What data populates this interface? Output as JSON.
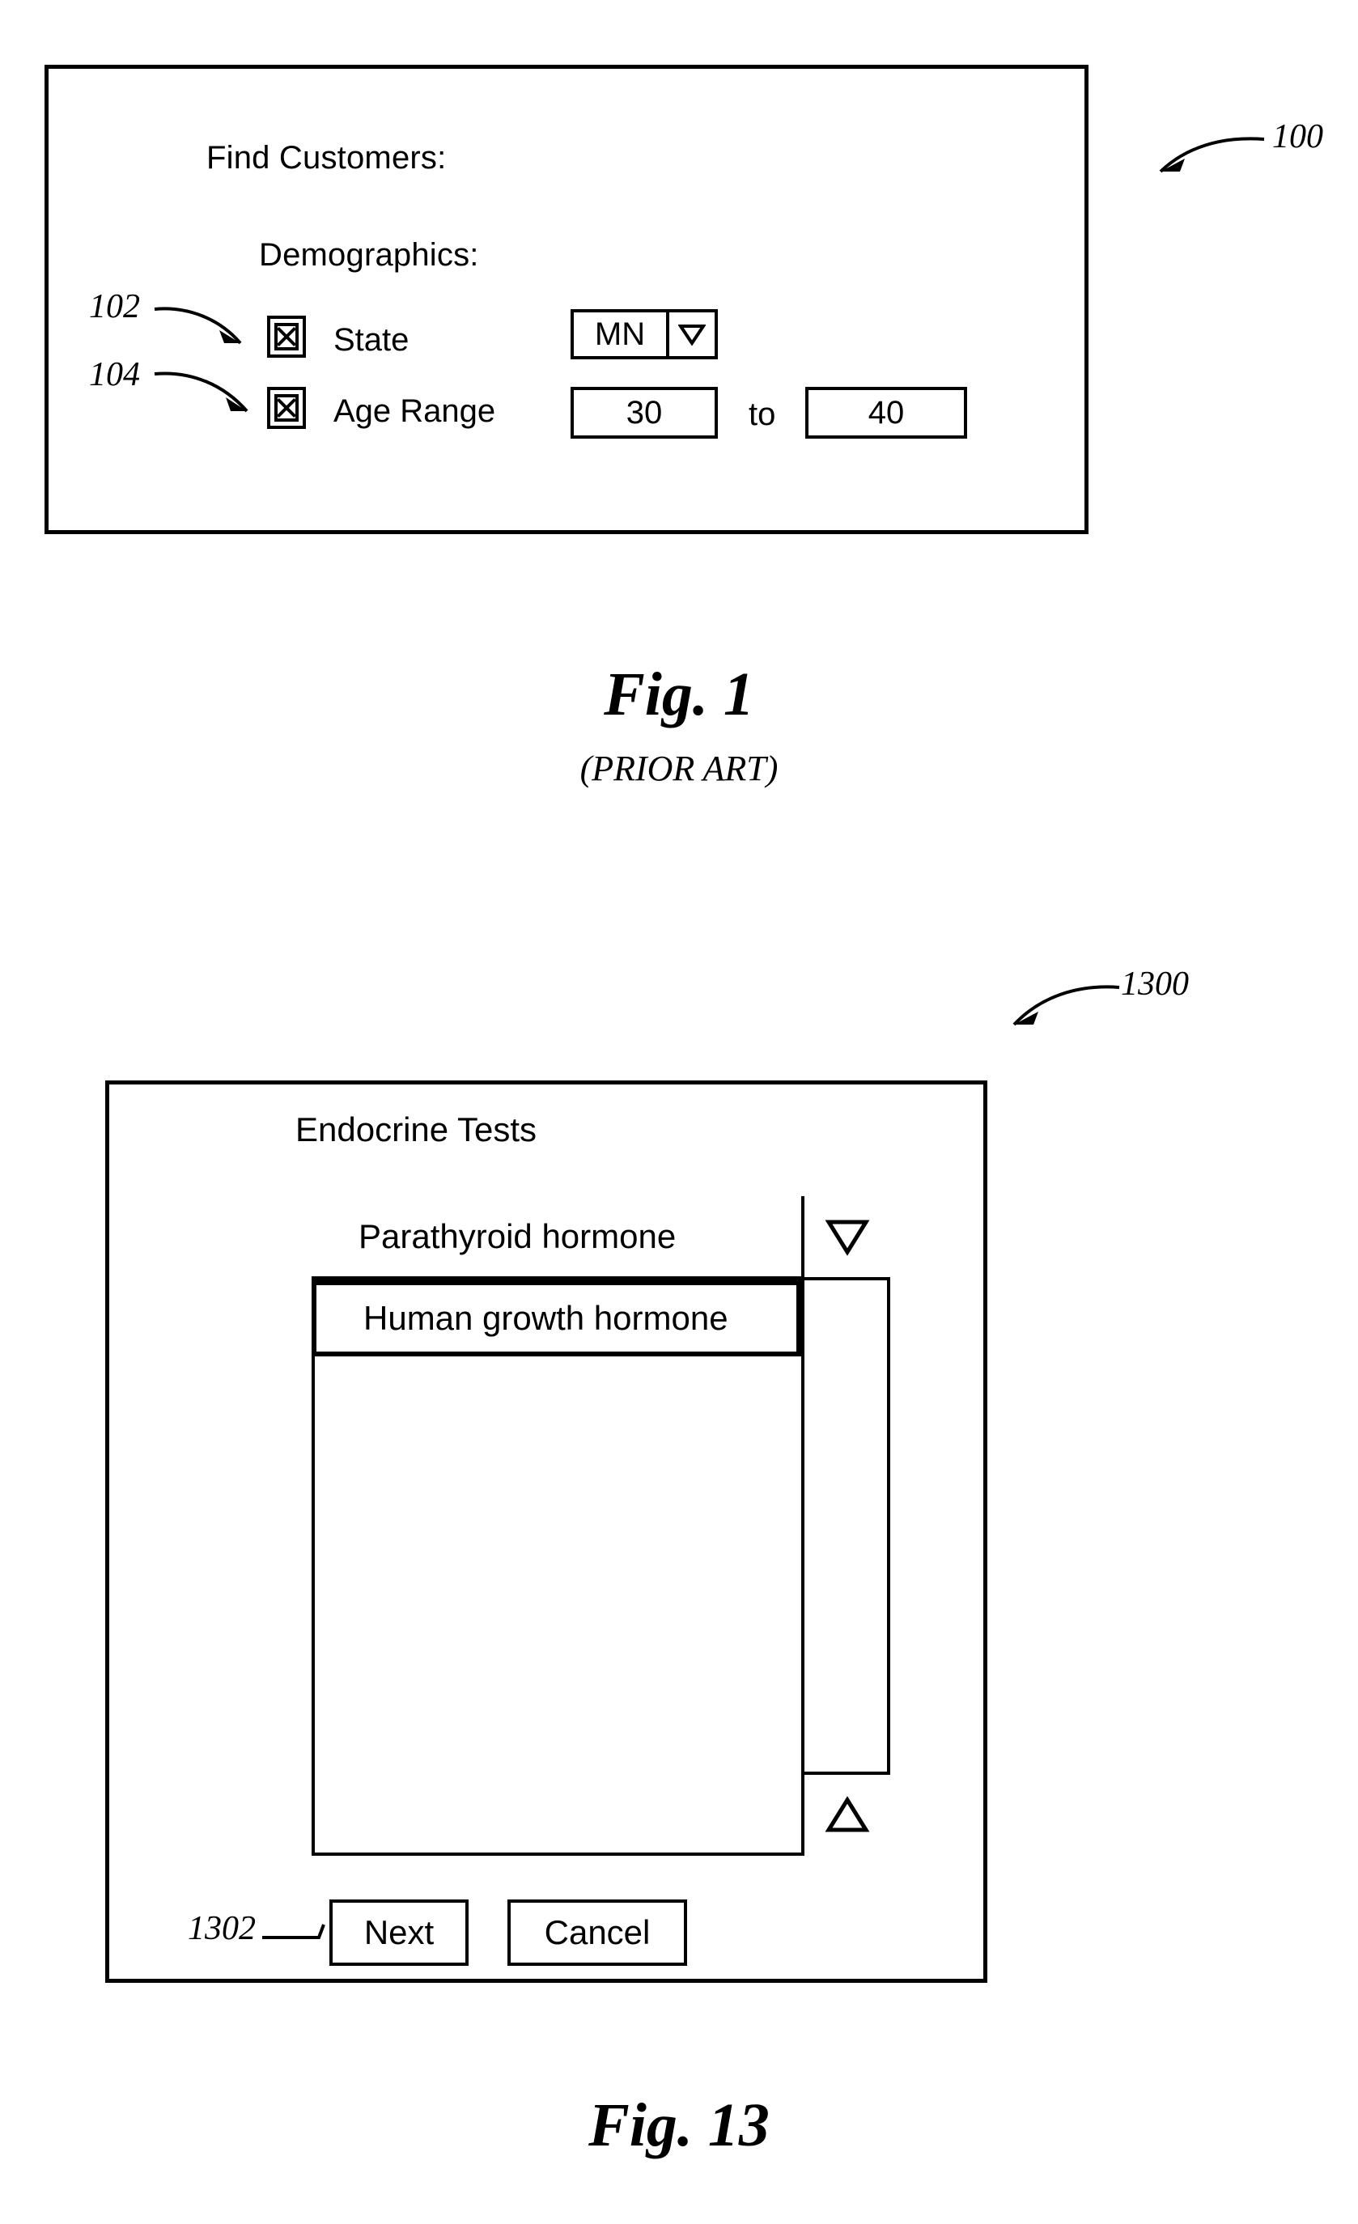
{
  "figures": [
    {
      "id": "fig1",
      "caption": "Fig.   1",
      "sub_caption": "(PRIOR ART)",
      "ref": "100",
      "dialog": {
        "title": "Find Customers:",
        "section_label": "Demographics:",
        "rows": [
          {
            "ref": "102",
            "checkbox_state": "checked",
            "checkbox_glyph": "x-mark",
            "label": "State",
            "control": "dropdown",
            "value": "MN",
            "arrow_glyph": "triangle-down"
          },
          {
            "ref": "104",
            "checkbox_state": "checked",
            "checkbox_glyph": "x-mark",
            "label": "Age Range",
            "control": "range",
            "from_value": "30",
            "separator": "to",
            "to_value": "40"
          }
        ]
      }
    },
    {
      "id": "fig13",
      "caption": "Fig.   13",
      "ref": "1300",
      "dialog": {
        "title": "Endocrine Tests",
        "list": {
          "items": [
            {
              "label": "Parathyroid hormone",
              "selected": false
            },
            {
              "label": "Human growth hormone",
              "selected": true
            }
          ],
          "scrollbar": {
            "top_button_glyph": "triangle-down",
            "bottom_button_glyph": "triangle-up"
          }
        },
        "buttons": [
          {
            "ref": "1302",
            "label": "Next"
          },
          {
            "ref": "",
            "label": "Cancel"
          }
        ]
      }
    }
  ],
  "colors": {
    "ink": "#000000",
    "paper": "#ffffff"
  }
}
